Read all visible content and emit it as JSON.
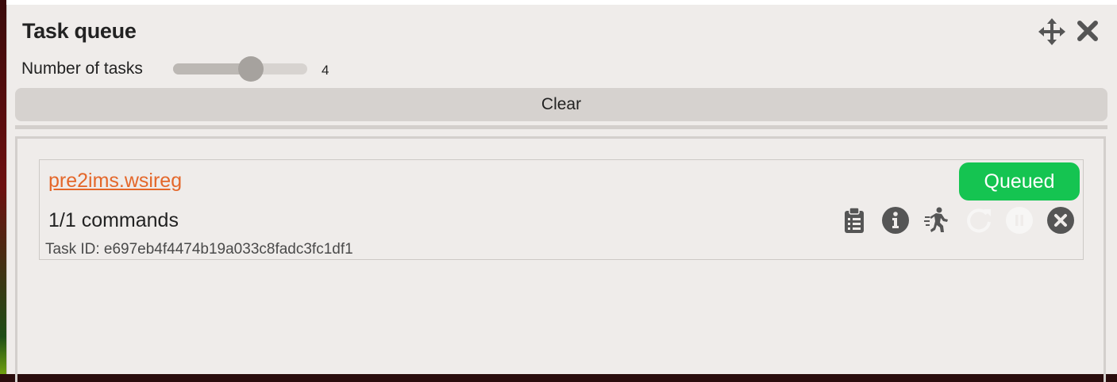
{
  "panel": {
    "title": "Task queue"
  },
  "slider": {
    "label": "Number of tasks",
    "value": "4",
    "fraction": 0.58
  },
  "clear_button": {
    "label": "Clear"
  },
  "tasks": [
    {
      "name": "pre2ims.wsireg",
      "commands": "1/1 commands",
      "task_id_text": "Task ID: e697eb4f4474b19a033c8fadc3fc1df1",
      "status": "Queued",
      "status_color": "#15c451",
      "actions": [
        "clipboard-list-icon",
        "info-icon",
        "running-person-icon",
        "retry-icon",
        "pause-icon",
        "cancel-icon"
      ]
    }
  ],
  "colors": {
    "accent_link": "#e4672a",
    "status_queued": "#15c451",
    "icon_dark": "#555555",
    "icon_disabled": "#f7f6f5"
  }
}
